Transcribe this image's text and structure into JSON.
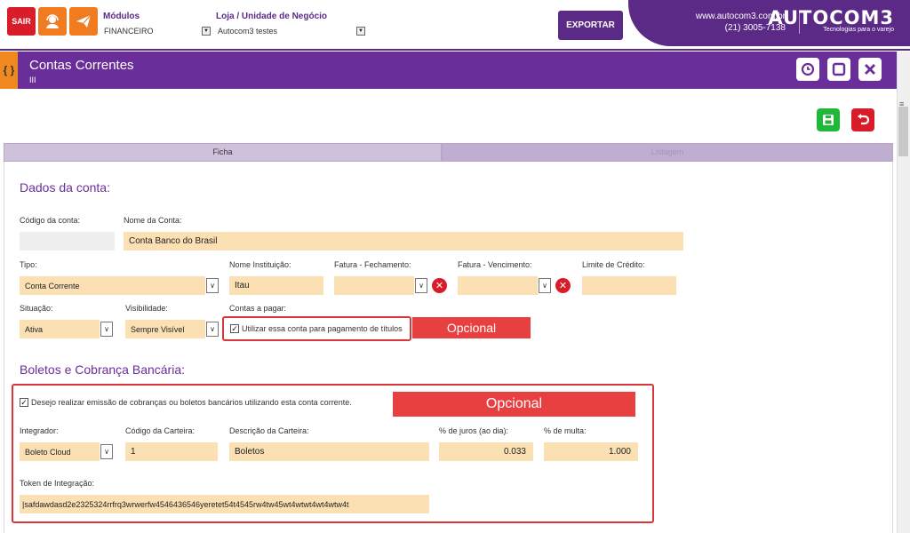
{
  "topbar": {
    "sair_label": "SAIR",
    "modulos_label": "Módulos",
    "modulos_value": "FINANCEIRO",
    "loja_label": "Loja / Unidade de Negócio",
    "loja_value": "Autocom3 testes",
    "export_label": "EXPORTAR",
    "site": "www.autocom3.com.br",
    "phone": "(21) 3005-7138",
    "brand_name": "AUTOCOM3",
    "brand_tagline": "Tecnologias para o varejo"
  },
  "titlebar": {
    "braces": "{ }",
    "title": "Contas Correntes",
    "subtitle": "III"
  },
  "tabs": {
    "ficha": "Ficha",
    "other": "Listagem"
  },
  "dados": {
    "section_title": "Dados da conta:",
    "codigo_label": "Código da conta:",
    "codigo_value": "",
    "nome_label": "Nome da Conta:",
    "nome_value": "Conta Banco do Brasil",
    "tipo_label": "Tipo:",
    "tipo_value": "Conta Corrente",
    "instituicao_label": "Nome Instituição:",
    "instituicao_value": "Itau",
    "fechamento_label": "Fatura - Fechamento:",
    "vencimento_label": "Fatura - Vencimento:",
    "limite_label": "Limite de Crédito:",
    "situacao_label": "Situação:",
    "situacao_value": "Ativa",
    "visibilidade_label": "Visibilidade:",
    "visibilidade_value": "Sempre Visível",
    "contas_pagar_label": "Contas a pagar:",
    "contas_pagar_check": "Utilizar essa conta para pagamento de títulos",
    "opcional_1": "Opcional"
  },
  "boletos": {
    "section_title": "Boletos e Cobrança Bancária:",
    "check_text": "Desejo realizar emissão de cobranças ou boletos bancários utilizando esta conta corrente.",
    "opcional_2": "Opcional",
    "integrador_label": "Integrador:",
    "integrador_value": "Boleto Cloud",
    "carteira_label": "Código da Carteira:",
    "carteira_value": "1",
    "descricao_label": "Descrição da Carteira:",
    "descricao_value": "Boletos",
    "juros_label": "% de juros (ao dia):",
    "juros_value": "0.033",
    "multa_label": "% de multa:",
    "multa_value": "1.000",
    "token_label": "Token de Integração:",
    "token_value": "|safdawdasd2e2325324rrfrq3wrwerfw4546436546yeretet54t4545rw4tw45wt4wtwt4wt4wtw4t"
  },
  "icons": {
    "support": "headset-icon",
    "send": "paper-plane-icon",
    "history": "clock-icon",
    "maximize": "square-icon",
    "close": "close-icon",
    "save": "save-icon",
    "back": "undo-icon"
  },
  "colors": {
    "primary": "#6a2e9a",
    "accent": "#f07b20",
    "danger": "#d81c2a",
    "field": "#fbe0b4"
  }
}
